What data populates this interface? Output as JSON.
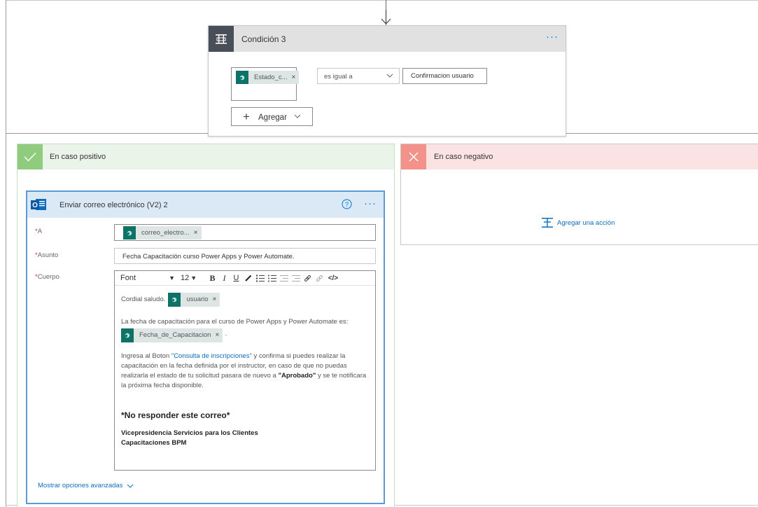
{
  "condition": {
    "title": "Condición 3",
    "more_label": "···",
    "token_left": "Estado_c...",
    "token_remove": "×",
    "operator": "es igual a",
    "value": "Confirmacion usuario",
    "add_label": "Agregar"
  },
  "yes_branch": {
    "title": "En caso positivo"
  },
  "no_branch": {
    "title": "En caso negativo",
    "add_action_label": "Agregar una acción"
  },
  "email": {
    "title": "Enviar correo electrónico (V2) 2",
    "more_label": "···",
    "to_label": "A",
    "required_mark": "*",
    "to_token": "correo_electro...",
    "subject_label": "Asunto",
    "subject_value": "Fecha Capacitación curso Power Apps y Power Automate.",
    "body_label": "Cuerpo",
    "toolbar": {
      "font": "Font",
      "size": "12",
      "bold": "B",
      "italic": "I",
      "underline": "U"
    },
    "body": {
      "greeting": "Cordial saludo.",
      "token_user": "usuario",
      "line1": "La fecha de capacitación para el curso de Power Apps y Power Automate es:",
      "token_date": "Fecha_de_Capacitacion",
      "after_date": "·",
      "p2_a": "Ingresa al Boton ",
      "p2_link": "\"Consulta de inscripciones\"",
      "p2_b": "  y confirma si puedes realizar la capacitación en la fecha definida por el instructor, en caso de que no puedas realizarla el estado de tu solicitud pasara de nuevo a ",
      "p2_bold": "\"Aprobado\"",
      "p2_c": " y se te notificara la próxima fecha disponible.",
      "no_reply": "*No responder este correo*",
      "sig1": "Vicepresidencia Servicios para los Clientes",
      "sig2": "Capacitaciones BPM"
    },
    "advanced_label": "Mostrar opciones avanzadas"
  },
  "colors": {
    "accent": "#0078d4",
    "condition_icon_bg": "#484f58",
    "yes_bg": "#eaf4e9",
    "yes_icon": "#8fcc7e",
    "no_bg": "#fce3e3",
    "no_icon": "#f2928a",
    "email_header": "#dbe9f7",
    "token_icon": "#0f7267"
  }
}
